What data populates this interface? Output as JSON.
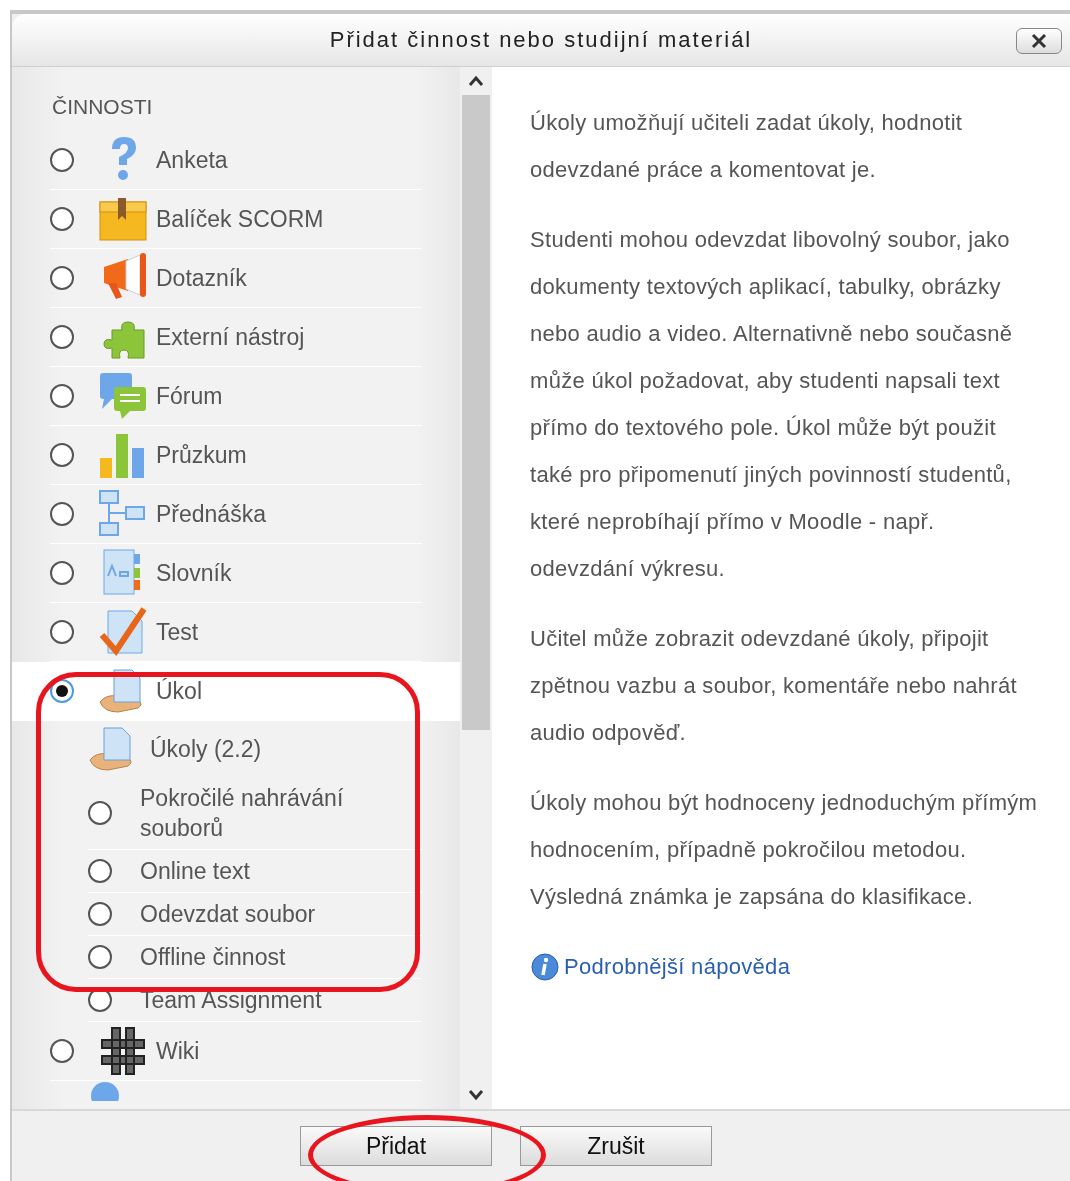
{
  "window": {
    "title": "Přidat činnost nebo studijní materiál"
  },
  "list": {
    "heading": "ČINNOSTI",
    "items": [
      {
        "kind": "activity",
        "label": "Anketa",
        "selected": false
      },
      {
        "kind": "activity",
        "label": "Balíček SCORM",
        "selected": false
      },
      {
        "kind": "activity",
        "label": "Dotazník",
        "selected": false
      },
      {
        "kind": "activity",
        "label": "Externí nástroj",
        "selected": false
      },
      {
        "kind": "activity",
        "label": "Fórum",
        "selected": false
      },
      {
        "kind": "activity",
        "label": "Průzkum",
        "selected": false
      },
      {
        "kind": "activity",
        "label": "Přednáška",
        "selected": false
      },
      {
        "kind": "activity",
        "label": "Slovník",
        "selected": false
      },
      {
        "kind": "activity",
        "label": "Test",
        "selected": false
      },
      {
        "kind": "activity",
        "label": "Úkol",
        "selected": true
      },
      {
        "kind": "group",
        "label": "Úkoly (2.2)",
        "children": [
          {
            "label": "Pokročilé nahrávání souborů",
            "selected": false
          },
          {
            "label": "Online text",
            "selected": false
          },
          {
            "label": "Odevzdat soubor",
            "selected": false
          },
          {
            "label": "Offline činnost",
            "selected": false
          },
          {
            "label": "Team Assignment",
            "selected": false
          }
        ]
      },
      {
        "kind": "activity",
        "label": "Wiki",
        "selected": false
      }
    ]
  },
  "description": {
    "paragraphs": [
      "Úkoly umožňují učiteli zadat úkoly, hodnotit odevzdané práce a komentovat je.",
      "Studenti mohou odevzdat libovolný soubor, jako dokumenty textových aplikací, tabulky, obrázky nebo audio a video. Alternativně nebo současně může úkol požadovat, aby studenti napsali text přímo do textového pole. Úkol může být použit také pro připomenutí jiných povinností studentů, které neprobíhají přímo v Moodle - např. odevzdání výkresu.",
      "Učitel může zobrazit odevzdané úkoly, připojit zpětnou vazbu a soubor, komentáře nebo nahrát audio odpověď.",
      "Úkoly mohou být hodnoceny jednoduchým přímým hodnocením, případně pokročilou metodou. Výsledná známka je zapsána do klasifikace."
    ],
    "help_link": "Podrobnější nápověda"
  },
  "buttons": [
    "Přidat",
    "Zrušit"
  ]
}
